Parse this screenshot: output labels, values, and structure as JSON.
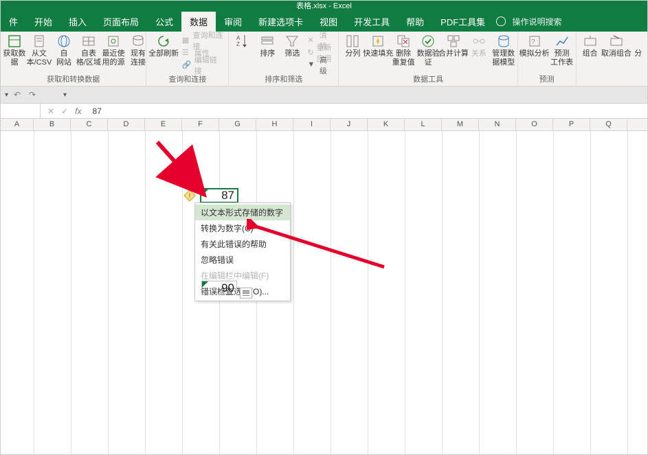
{
  "title": "表格.xlsx  -  Excel",
  "tabs": [
    "件",
    "开始",
    "插入",
    "页面布局",
    "公式",
    "数据",
    "审阅",
    "新建选项卡",
    "视图",
    "开发工具",
    "帮助",
    "PDF工具集"
  ],
  "active_tab_index": 5,
  "tell_me": "操作说明搜索",
  "ribbon": {
    "g1": {
      "label": "获取和转换数据",
      "btns": [
        "获取数\n据",
        "从文\n本/CSV",
        "自\n网站",
        "自表\n格/区域",
        "最近使\n用的源",
        "现有\n连接"
      ]
    },
    "g2": {
      "label": "查询和连接",
      "big": "全部刷新",
      "mini": [
        "查询和连接",
        "属性",
        "编辑链接"
      ]
    },
    "g3": {
      "label": "排序和筛选",
      "btns": [
        "↓↑",
        "排序",
        "筛选"
      ],
      "mini": [
        "清除",
        "重新应用",
        "高级"
      ]
    },
    "g4": {
      "label": "数据工具",
      "btns": [
        "分列",
        "快速填充",
        "删除\n重复值",
        "数据验\n证",
        "合并计算",
        "关系",
        "管理数\n据模型"
      ]
    },
    "g5": {
      "label": "预测",
      "btns": [
        "模拟分析",
        "预测\n工作表"
      ]
    },
    "g6": {
      "btns": [
        "组合",
        "取消组合",
        "分"
      ]
    }
  },
  "formula_bar": {
    "name": "",
    "value": "87"
  },
  "columns": [
    "A",
    "B",
    "C",
    "D",
    "E",
    "F",
    "G",
    "H",
    "I",
    "J",
    "K",
    "L",
    "M",
    "N",
    "O",
    "P",
    "Q"
  ],
  "selected_cell": {
    "value": "87"
  },
  "other_cell": {
    "value": "90"
  },
  "ctx_menu": {
    "items": [
      {
        "label": "以文本形式存储的数字",
        "hl": true
      },
      {
        "label": "转换为数字(C)"
      },
      {
        "label": "有关此错误的帮助"
      },
      {
        "label": "忽略错误"
      },
      {
        "label": "在编辑栏中编辑(F)",
        "dis": true
      },
      {
        "label": "错误检查选项(O)..."
      }
    ]
  }
}
